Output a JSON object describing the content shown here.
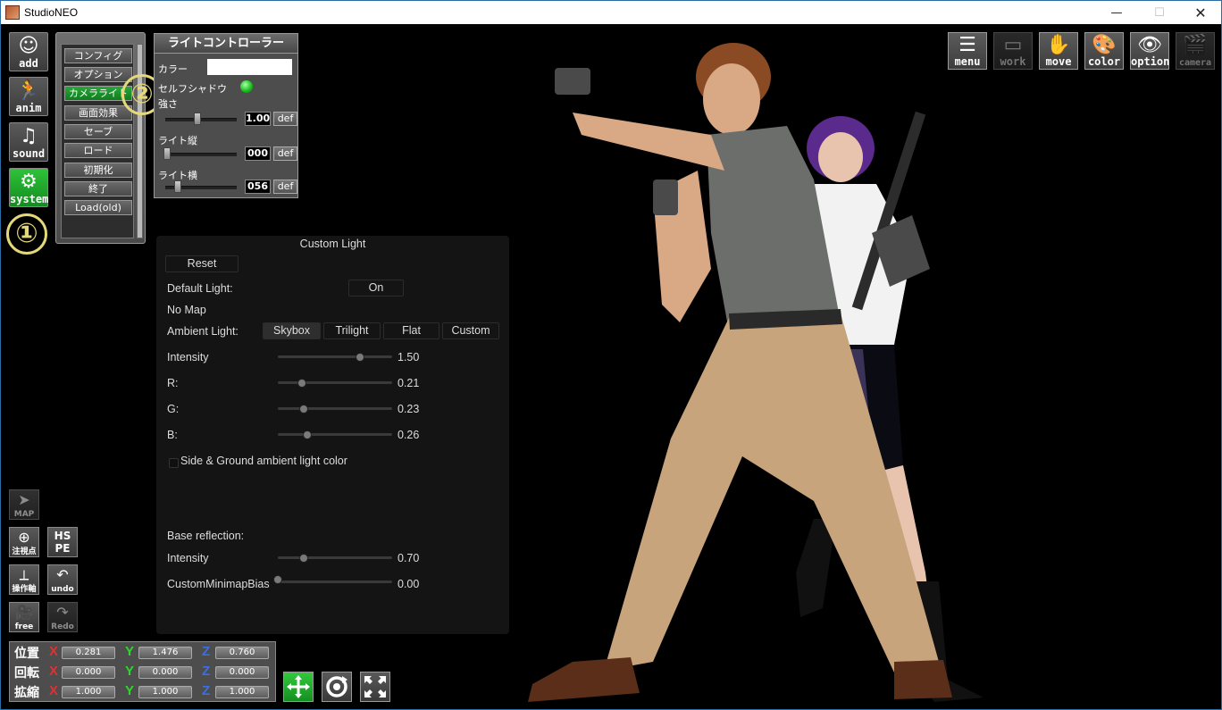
{
  "window": {
    "title": "StudioNEO",
    "controls": {
      "minimize": "—",
      "maximize": "☐",
      "close": "✕"
    }
  },
  "left_tools": [
    {
      "label": "add",
      "icon": "person-add-icon",
      "glyph": "☺"
    },
    {
      "label": "anim",
      "icon": "running-person-icon",
      "glyph": "🏃"
    },
    {
      "label": "sound",
      "icon": "music-note-icon",
      "glyph": "♫"
    },
    {
      "label": "system",
      "icon": "gears-icon",
      "glyph": "⚙",
      "active": true
    }
  ],
  "annotations": {
    "one": "①",
    "two": "②"
  },
  "system_menu": {
    "items": [
      {
        "label": "コンフィグ"
      },
      {
        "label": "オプション"
      },
      {
        "label": "カメラライト",
        "active": true
      },
      {
        "label": "画面効果"
      },
      {
        "label": "セーブ"
      },
      {
        "label": "ロード"
      },
      {
        "label": "初期化"
      },
      {
        "label": "終了"
      },
      {
        "label": "Load(old)"
      }
    ]
  },
  "light_controller": {
    "title": "ライトコントローラー",
    "color_label": "カラー",
    "color_value": "#ffffff",
    "self_shadow_label": "セルフシャドウ",
    "self_shadow_on": true,
    "strength_label": "強さ",
    "strength_value": "1.00",
    "vertical_label": "ライト縦",
    "vertical_value": "000",
    "horizontal_label": "ライト横",
    "horizontal_value": "056",
    "def_label": "def"
  },
  "custom_light": {
    "title": "Custom Light",
    "reset_label": "Reset",
    "default_light_label": "Default Light:",
    "default_light_value": "On",
    "no_map_label": "No Map",
    "ambient_label": "Ambient Light:",
    "ambient_options": [
      "Skybox",
      "Trilight",
      "Flat",
      "Custom"
    ],
    "ambient_selected": "Skybox",
    "sliders": [
      {
        "label": "Intensity",
        "value": "1.50",
        "fraction": 0.72
      },
      {
        "label": "R:",
        "value": "0.21",
        "fraction": 0.21
      },
      {
        "label": "G:",
        "value": "0.23",
        "fraction": 0.23
      },
      {
        "label": "B:",
        "value": "0.26",
        "fraction": 0.26
      }
    ],
    "side_ground_label": "Side & Ground ambient light color",
    "side_ground_checked": false,
    "base_reflection_label": "Base reflection:",
    "base_reflection": {
      "label": "Intensity",
      "value": "0.70",
      "fraction": 0.23
    },
    "minimap_bias": {
      "label": "CustomMinimapBias",
      "value": "0.00",
      "fraction": 0.0
    }
  },
  "top_right_icons": [
    {
      "label": "menu",
      "icon": "list-menu-icon",
      "glyph": "☰"
    },
    {
      "label": "work",
      "icon": "work-frame-icon",
      "glyph": "▭",
      "dim": true
    },
    {
      "label": "move",
      "icon": "hand-move-icon",
      "glyph": "✋"
    },
    {
      "label": "color",
      "icon": "palette-icon",
      "glyph": "🎨"
    },
    {
      "label": "option",
      "icon": "eye-icon",
      "glyph": "👁"
    },
    {
      "label": "camera",
      "icon": "clapperboard-icon",
      "glyph": "🎬",
      "dim": true
    }
  ],
  "bottom_tools": [
    {
      "label": "MAP",
      "icon": "map-arrow-icon",
      "glyph": "➤",
      "dim": true
    },
    {
      "label": "注視点",
      "icon": "target-plus-icon",
      "glyph": "⊕"
    },
    {
      "label": "HS PE",
      "icon": "hspe-icon",
      "glyph": "HS"
    },
    {
      "label": "操作軸",
      "icon": "axis-icon",
      "glyph": "⟂"
    },
    {
      "label": "undo",
      "icon": "undo-arrow-icon",
      "glyph": "↶"
    },
    {
      "label": "free",
      "icon": "video-camera-icon",
      "glyph": "🎥"
    },
    {
      "label": "Redo",
      "icon": "redo-arrow-icon",
      "glyph": "↷",
      "dim": true
    }
  ],
  "transform": {
    "position_label": "位置",
    "rotation_label": "回転",
    "scale_label": "拡縮",
    "axis_x": "X",
    "axis_y": "Y",
    "axis_z": "Z",
    "position": [
      "0.281",
      "1.476",
      "0.760"
    ],
    "rotation": [
      "0.000",
      "0.000",
      "0.000"
    ],
    "scale": [
      "1.000",
      "1.000",
      "1.000"
    ],
    "colors": {
      "x": "#e23030",
      "y": "#2fd62f",
      "z": "#3b6fe6"
    }
  },
  "gizmos": [
    {
      "icon": "move-gizmo-icon",
      "glyph": "✥",
      "active": true
    },
    {
      "icon": "rotate-gizmo-icon",
      "glyph": "⟳"
    },
    {
      "icon": "scale-gizmo-icon",
      "glyph": "⤢"
    }
  ]
}
